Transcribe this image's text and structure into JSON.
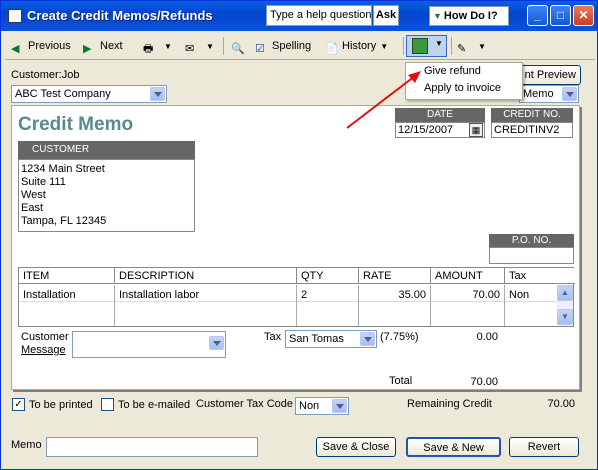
{
  "titlebar": {
    "title": "Create Credit Memos/Refunds",
    "help_placeholder": "Type a help question",
    "ask_label": "Ask",
    "howdo_label": "How Do I?",
    "min_icon": "minimize-icon",
    "max_icon": "maximize-icon",
    "close_icon": "close-icon"
  },
  "toolbar": {
    "previous": "Previous",
    "next": "Next",
    "spelling": "Spelling",
    "history": "History"
  },
  "dropdown_menu": {
    "items": [
      "Give refund",
      "Apply to invoice"
    ]
  },
  "customer": {
    "label": "Customer:Job",
    "value": "ABC Test Company"
  },
  "preview_button": "nt Preview",
  "template_value": "Memo",
  "form": {
    "heading": "Credit Memo",
    "date_label": "DATE",
    "date_value": "12/15/2007",
    "creditno_label": "CREDIT NO.",
    "creditno_value": "CREDITINV2",
    "customer_label": "CUSTOMER",
    "address": [
      "1234 Main Street",
      "Suite 111",
      "West",
      "East",
      "Tampa, FL 12345"
    ],
    "po_label": "P.O. NO.",
    "columns": {
      "item": "ITEM",
      "description": "DESCRIPTION",
      "qty": "QTY",
      "rate": "RATE",
      "amount": "AMOUNT",
      "tax": "Tax"
    },
    "rows": [
      {
        "item": "Installation",
        "description": "Installation labor",
        "qty": "2",
        "rate": "35.00",
        "amount": "70.00",
        "tax": "Non"
      }
    ],
    "customer_message_label1": "Customer",
    "customer_message_label2": "Message",
    "tax_label": "Tax",
    "tax_value": "San Tomas",
    "tax_rate": "(7.75%)",
    "tax_amount": "0.00",
    "total_label": "Total",
    "total_value": "70.00"
  },
  "footer": {
    "to_be_printed": "To be printed",
    "to_be_emailed": "To be e-mailed",
    "customer_tax_code_label": "Customer Tax Code",
    "customer_tax_code_value": "Non",
    "remaining_credit_label": "Remaining Credit",
    "remaining_credit_value": "70.00",
    "memo_label": "Memo",
    "save_close": "Save & Close",
    "save_new": "Save & New",
    "revert": "Revert"
  },
  "colors": {
    "titlebar": "#0a52d9",
    "form_heading": "#5a8a8a",
    "arrow": "#e01010"
  }
}
